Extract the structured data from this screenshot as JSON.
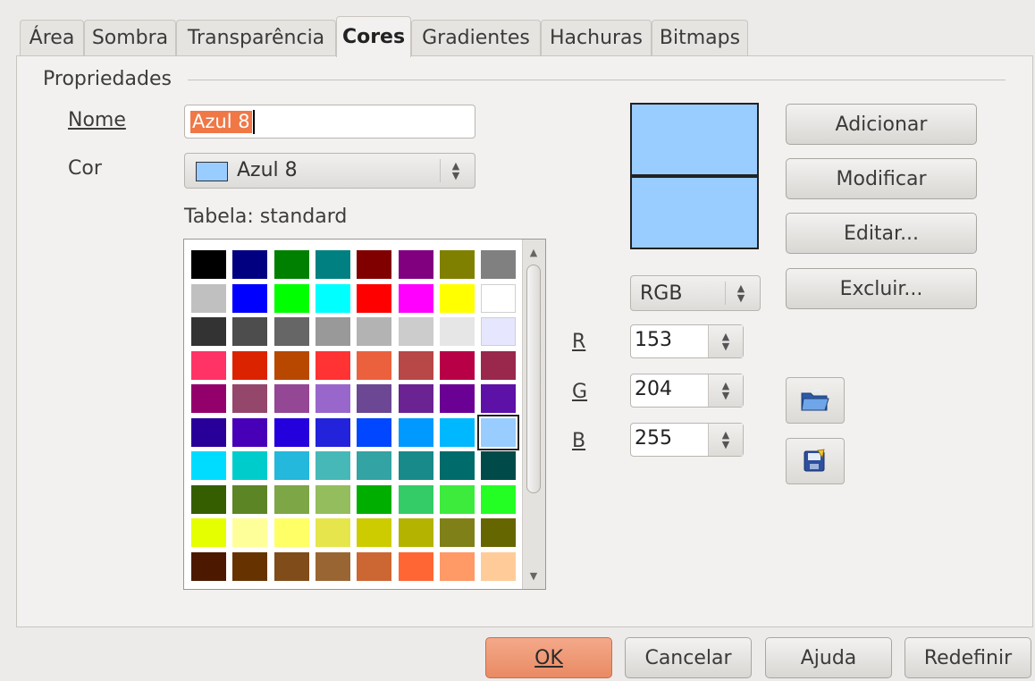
{
  "tabs": [
    {
      "label": "Área"
    },
    {
      "label": "Sombra"
    },
    {
      "label": "Transparência"
    },
    {
      "label": "Cores"
    },
    {
      "label": "Gradientes"
    },
    {
      "label": "Hachuras"
    },
    {
      "label": "Bitmaps"
    }
  ],
  "active_tab": "Cores",
  "properties": {
    "section_title": "Propriedades",
    "name_label": "Nome",
    "name_value": "Azul 8",
    "color_label": "Cor",
    "color_value": "Azul 8",
    "color_swatch": "#99ccff",
    "table_label": "Tabela: standard"
  },
  "palette": [
    [
      "#000000",
      "#000080",
      "#008000",
      "#008080",
      "#800000",
      "#800080",
      "#808000",
      "#808080"
    ],
    [
      "#c0c0c0",
      "#0000ff",
      "#00ff00",
      "#00ffff",
      "#ff0000",
      "#ff00ff",
      "#ffff00",
      "#ffffff"
    ],
    [
      "#333333",
      "#4d4d4d",
      "#666666",
      "#999999",
      "#b3b3b3",
      "#cccccc",
      "#e6e6e6",
      "#e6e6ff"
    ],
    [
      "#ff3366",
      "#dc2300",
      "#b84700",
      "#ff3333",
      "#eb613d",
      "#b84747",
      "#b80047",
      "#99284c"
    ],
    [
      "#94006b",
      "#94476b",
      "#944794",
      "#9966cc",
      "#6b4794",
      "#6b2394",
      "#6b0094",
      "#5e11a6"
    ],
    [
      "#280099",
      "#4700b8",
      "#2300dc",
      "#2323dc",
      "#0047ff",
      "#0099ff",
      "#00b8ff",
      "#99ccff"
    ],
    [
      "#00dcff",
      "#00cccc",
      "#23b8dc",
      "#47b8b8",
      "#33a3a3",
      "#198a8a",
      "#006b6b",
      "#004a4a"
    ],
    [
      "#355e00",
      "#5c8526",
      "#7da647",
      "#94bd5e",
      "#00ae00",
      "#33cc66",
      "#3deb3d",
      "#23ff23"
    ],
    [
      "#e6ff00",
      "#ffff99",
      "#ffff66",
      "#e6e64c",
      "#cccc00",
      "#b3b300",
      "#808019",
      "#666600"
    ],
    [
      "#4c1900",
      "#663300",
      "#804c19",
      "#996633",
      "#cc6633",
      "#ff6633",
      "#ff9966",
      "#ffcc99"
    ]
  ],
  "selected_cell": [
    5,
    7
  ],
  "preview": {
    "old_color": "#99ccff",
    "new_color": "#99ccff"
  },
  "color_model": "RGB",
  "rgb": {
    "r_label": "R",
    "r_value": "153",
    "g_label": "G",
    "g_value": "204",
    "b_label": "B",
    "b_value": "255"
  },
  "side_buttons": {
    "add": "Adicionar",
    "modify": "Modificar",
    "edit": "Editar...",
    "delete": "Excluir..."
  },
  "icons": {
    "load": "open-folder-icon",
    "save": "save-palette-icon"
  },
  "footer_buttons": {
    "ok": "OK",
    "cancel": "Cancelar",
    "help": "Ajuda",
    "reset": "Redefinir"
  }
}
